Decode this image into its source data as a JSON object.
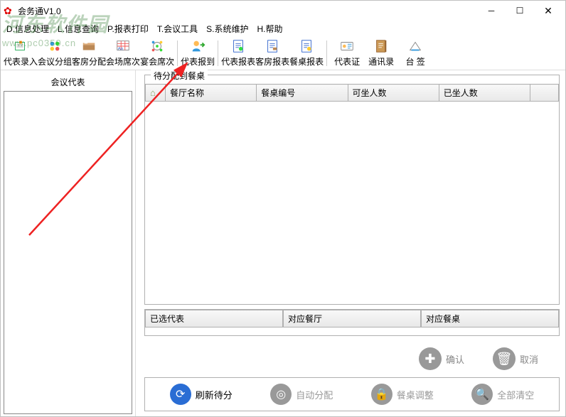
{
  "window": {
    "title": "会务通V1.0"
  },
  "menu": [
    "D.信息处理",
    "L.信息查询",
    "P.报表打印",
    "T.会议工具",
    "S.系统维护",
    "H.帮助"
  ],
  "toolbar": [
    "代表录入",
    "会议分组",
    "客房分配",
    "会场席次",
    "宴会席次",
    "代表报到",
    "代表报表",
    "客房报表",
    "餐桌报表",
    "代表证",
    "通讯录",
    "台  签"
  ],
  "leftPanel": {
    "title": "会议代表"
  },
  "tableGroup": {
    "legend": "待分配到餐桌",
    "columns": [
      "餐厅名称",
      "餐桌编号",
      "可坐人数",
      "已坐人数"
    ]
  },
  "selectedGroup": {
    "columns": [
      "已选代表",
      "对应餐厅",
      "对应餐桌"
    ]
  },
  "confirm": {
    "ok": "确认",
    "cancel": "取消"
  },
  "bottom": {
    "refresh": "刷新待分",
    "auto": "自动分配",
    "adjust": "餐桌调整",
    "clear": "全部清空"
  },
  "watermark": {
    "main": "河东软件园",
    "sub": "www.pc0359.cn"
  }
}
